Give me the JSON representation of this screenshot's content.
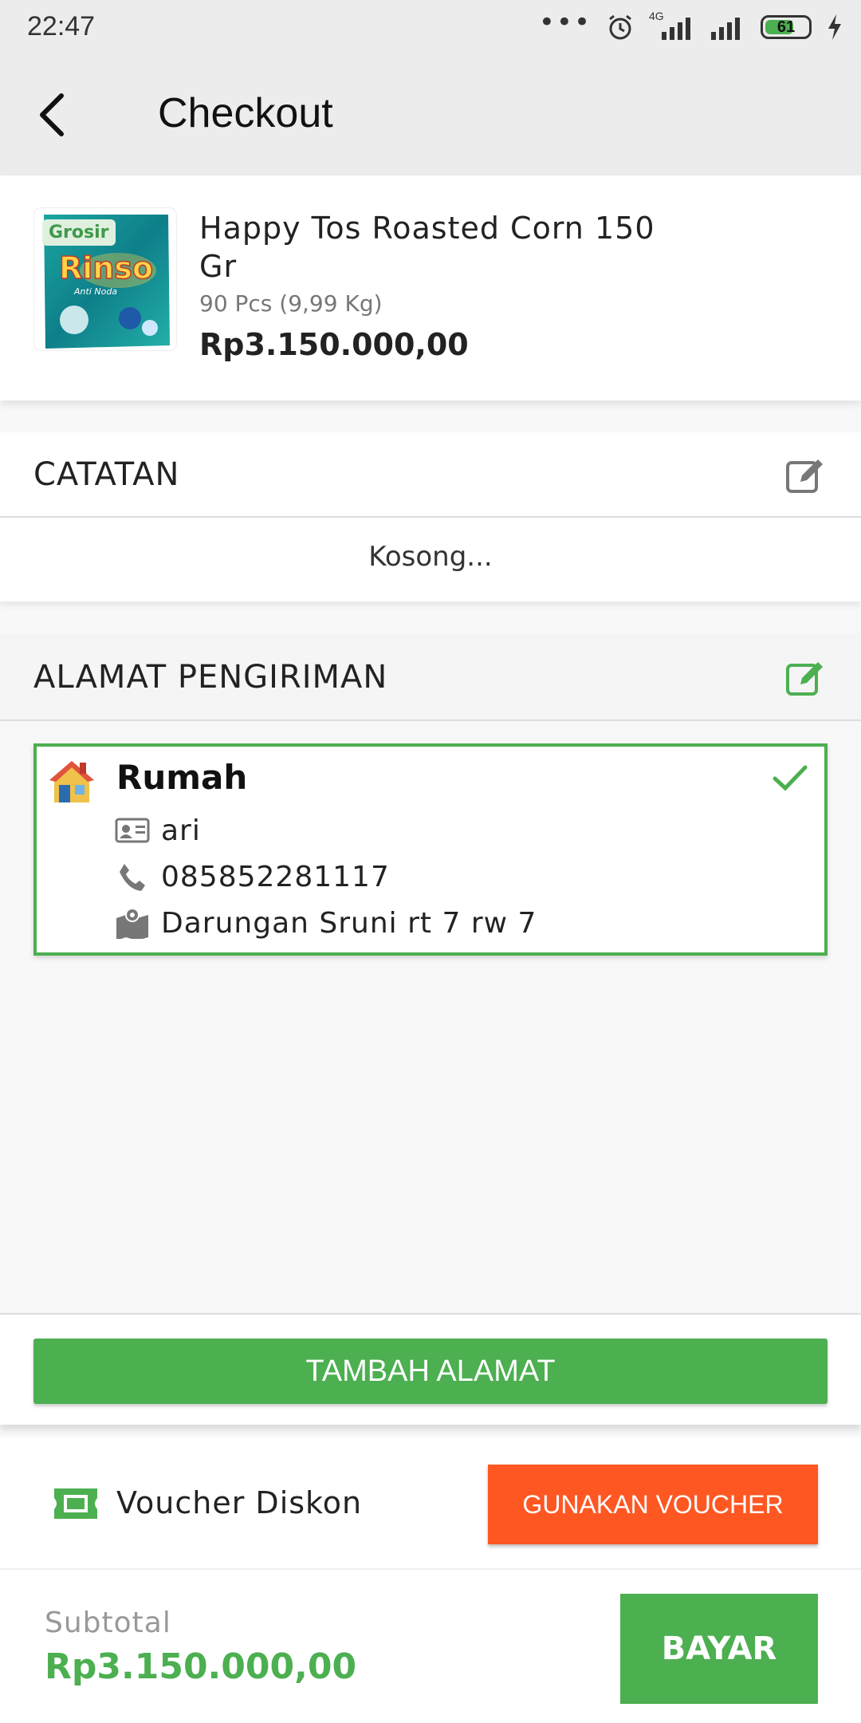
{
  "status_bar": {
    "time": "22:47",
    "battery": "61",
    "network": "4G"
  },
  "app_bar": {
    "title": "Checkout",
    "back_icon": "back-arrow-icon"
  },
  "product": {
    "badge": "Grosir",
    "name": "Happy Tos Roasted Corn 150 Gr",
    "quantity": "90 Pcs (9,99 Kg)",
    "price": "Rp3.150.000,00",
    "image_brand": "Rinso",
    "image_subtext": "Anti Noda"
  },
  "notes": {
    "title": "CATATAN",
    "empty_text": "Kosong..."
  },
  "shipping": {
    "title": "ALAMAT PENGIRIMAN",
    "addresses": [
      {
        "label": "Rumah",
        "name": "ari",
        "phone": "085852281117",
        "address": "Darungan Sruni rt 7 rw 7",
        "selected": true
      }
    ],
    "add_button": "TAMBAH ALAMAT"
  },
  "voucher": {
    "label": "Voucher Diskon",
    "button": "GUNAKAN VOUCHER"
  },
  "footer": {
    "subtotal_label": "Subtotal",
    "subtotal_value": "Rp3.150.000,00",
    "pay_button": "BAYAR"
  },
  "colors": {
    "accent": "#4caf50",
    "voucher": "#ff5722",
    "app_bar": "#ececec"
  }
}
